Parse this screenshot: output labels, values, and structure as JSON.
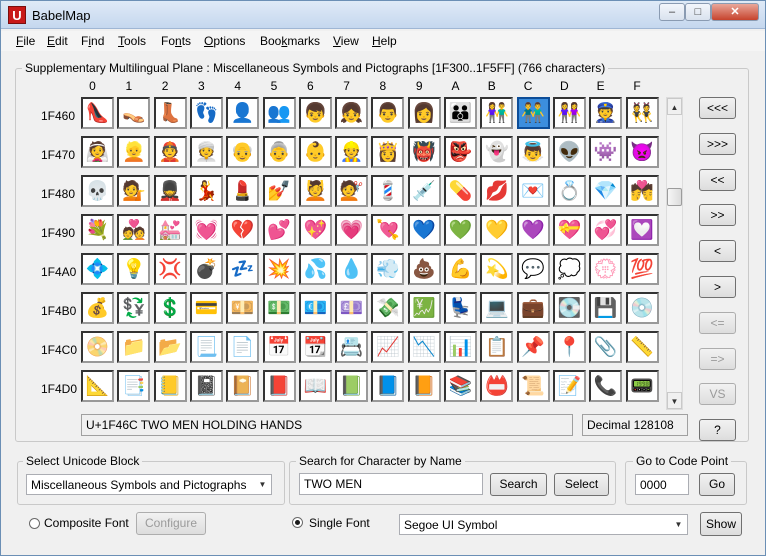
{
  "window": {
    "title": "BabelMap",
    "app_icon": "U"
  },
  "menu": [
    {
      "label": "File",
      "u": "F"
    },
    {
      "label": "Edit",
      "u": "E"
    },
    {
      "label": "Find",
      "u": "i"
    },
    {
      "label": "Tools",
      "u": "T"
    },
    {
      "label": "Fonts",
      "u": "n"
    },
    {
      "label": "Options",
      "u": "O"
    },
    {
      "label": "Bookmarks",
      "u": "k"
    },
    {
      "label": "View",
      "u": "V"
    },
    {
      "label": "Help",
      "u": "H"
    }
  ],
  "grid": {
    "header": "Supplementary Multilingual Plane : Miscellaneous Symbols and Pictographs [1F300..1F5FF] (766 characters)",
    "columns": [
      "0",
      "1",
      "2",
      "3",
      "4",
      "5",
      "6",
      "7",
      "8",
      "9",
      "A",
      "B",
      "C",
      "D",
      "E",
      "F"
    ],
    "rows": [
      "1F460",
      "1F470",
      "1F480",
      "1F490",
      "1F4A0",
      "1F4B0",
      "1F4C0",
      "1F4D0"
    ],
    "row_codes": [
      128096,
      128112,
      128128,
      128144,
      128160,
      128176,
      128192,
      128208
    ],
    "selected_cell": {
      "row": 0,
      "col": 12
    },
    "status_name": "U+1F46C TWO MEN HOLDING HANDS",
    "status_decimal": "Decimal 128108"
  },
  "nav_buttons": [
    {
      "label": "<<<",
      "enabled": true
    },
    {
      "label": ">>>",
      "enabled": true
    },
    {
      "label": "<<",
      "enabled": true
    },
    {
      "label": ">>",
      "enabled": true
    },
    {
      "label": "<",
      "enabled": true
    },
    {
      "label": ">",
      "enabled": true
    },
    {
      "label": "<=",
      "enabled": false
    },
    {
      "label": "=>",
      "enabled": false
    },
    {
      "label": "VS",
      "enabled": false
    },
    {
      "label": "?",
      "enabled": true
    }
  ],
  "unicode_block": {
    "label": "Select Unicode Block",
    "value": "Miscellaneous Symbols and Pictographs"
  },
  "search": {
    "label": "Search for Character by Name",
    "value": "TWO MEN",
    "search_button": "Search",
    "select_button": "Select"
  },
  "goto": {
    "label": "Go to Code Point",
    "value": "0000",
    "go_button": "Go"
  },
  "font": {
    "composite_label": "Composite Font",
    "configure_button": "Configure",
    "single_label": "Single Font",
    "selected_mode": "single",
    "font_name": "Segoe UI Symbol",
    "show_button": "Show"
  },
  "icons": {
    "minimize": "minimize-icon",
    "maximize": "maximize-icon",
    "close": "close-icon",
    "combo": "chevron-down-icon",
    "scroll_up": "arrow-up-icon",
    "scroll_down": "arrow-down-icon"
  },
  "colors": {
    "selection": "#3c8ede",
    "close_button": "#c6432d",
    "app_icon": "#c81818"
  }
}
